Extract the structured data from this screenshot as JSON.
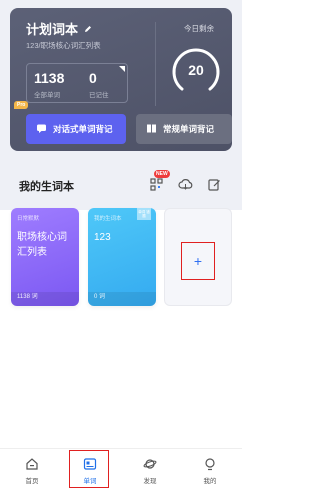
{
  "plan": {
    "title": "计划词本",
    "subtitle": "123/职场核心词汇列表",
    "total_words": "1138",
    "total_label": "全部单词",
    "remembered": "0",
    "remembered_label": "已记住",
    "today_label": "今日剩余",
    "today_remaining": "20",
    "dialog_button": "对话式单词背记",
    "pro_badge": "Pro",
    "normal_button": "常规单词背记"
  },
  "notebooks": {
    "section_title": "我的生词本",
    "new_badge": "NEW",
    "items": [
      {
        "tag": "日常默默",
        "name": "职场核心词汇列表",
        "count": "1138 词"
      },
      {
        "tag": "我的生词本",
        "ribbon": "单词 错题",
        "name": "123",
        "count": "0 词"
      }
    ],
    "add_label": "+"
  },
  "tabs": [
    {
      "label": "首页",
      "icon": "home-icon"
    },
    {
      "label": "单词",
      "icon": "word-card-icon",
      "active": true
    },
    {
      "label": "发现",
      "icon": "planet-icon"
    },
    {
      "label": "我的",
      "icon": "profile-icon"
    }
  ],
  "colors": {
    "plan_card": "#5c6177",
    "dialog_button": "#5d62ef",
    "normal_button": "#6b6f80",
    "book_purple": "#8a66f8",
    "book_blue": "#3fb6f4",
    "accent": "#1f6fe8",
    "highlight": "#e02020"
  }
}
